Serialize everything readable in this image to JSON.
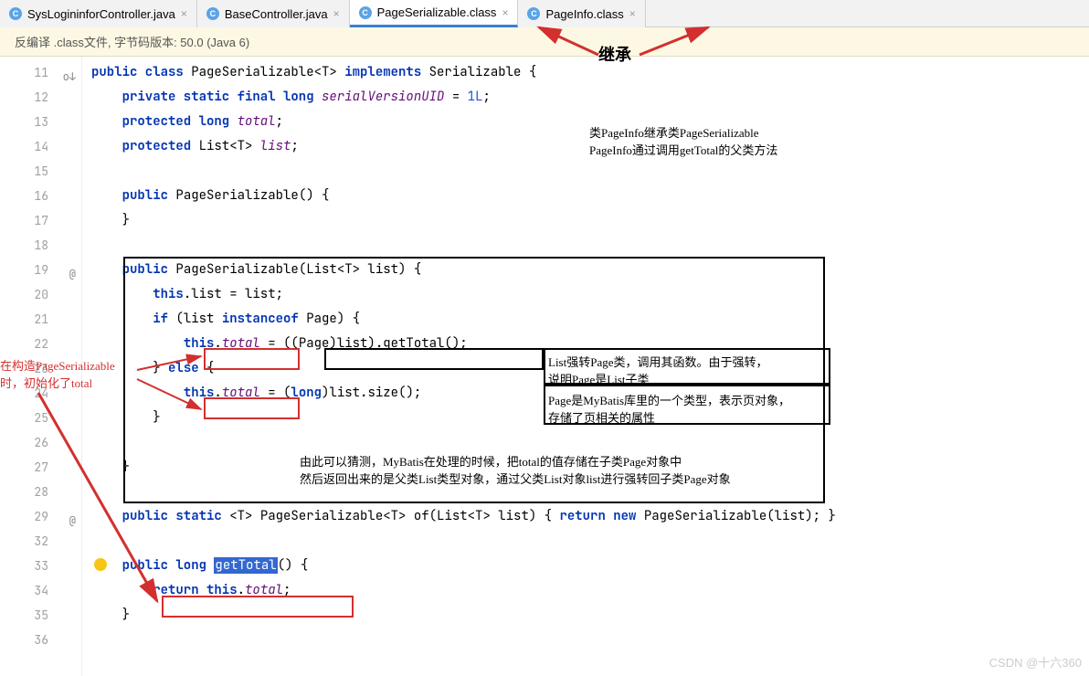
{
  "tabs": [
    {
      "label": "SysLogininforController.java",
      "icon": "C"
    },
    {
      "label": "BaseController.java",
      "icon": "C"
    },
    {
      "label": "PageSerializable.class",
      "icon": "C",
      "active": true
    },
    {
      "label": "PageInfo.class",
      "icon": "C"
    }
  ],
  "banner": "反编译 .class文件, 字节码版本: 50.0 (Java 6)",
  "lines": {
    "n11": "11",
    "n12": "12",
    "n13": "13",
    "n14": "14",
    "n15": "15",
    "n16": "16",
    "n17": "17",
    "n18": "18",
    "n19": "19",
    "n20": "20",
    "n21": "21",
    "n22": "22",
    "n23": "23",
    "n24": "24",
    "n25": "25",
    "n26": "26",
    "n27": "27",
    "n28": "28",
    "n29": "29",
    "n32": "32",
    "n33": "33",
    "n34": "34",
    "n35": "35",
    "n36": "36"
  },
  "code": {
    "l11": {
      "k1": "public class",
      "t1": " PageSerializable<",
      "t2": "T",
      "t3": "> ",
      "k2": "implements",
      "t4": " Serializable {"
    },
    "l12": {
      "k1": "private static final long ",
      "id": "serialVersionUID",
      "t1": " = ",
      "n": "1L",
      "t2": ";"
    },
    "l13": {
      "k1": "protected long ",
      "id": "total",
      "t1": ";"
    },
    "l14": {
      "k1": "protected ",
      "t1": "List<",
      "t2": "T",
      "t3": "> ",
      "id": "list",
      "t4": ";"
    },
    "l16": {
      "k1": "public",
      "t1": " PageSerializable() {"
    },
    "l17": {
      "t1": "}"
    },
    "l19": {
      "k1": "public",
      "t1": " PageSerializable(List<",
      "t2": "T",
      "t3": "> list) {"
    },
    "l20": {
      "k1": "this",
      "t1": ".list = list;"
    },
    "l21": {
      "k1": "if",
      "t1": " (list ",
      "k2": "instanceof",
      "t2": " Page) {"
    },
    "l22": {
      "k1": "this",
      "t1": ".",
      "id": "total",
      "t2": " = ",
      "t3": "((Page)list).getTotal();"
    },
    "l23": {
      "t1": "} ",
      "k1": "else",
      "t2": " {"
    },
    "l24": {
      "k1": "this",
      "t1": ".",
      "id": "total",
      "t2": " = (",
      "k2": "long",
      "t3": ")list.size();"
    },
    "l25": {
      "t1": "}"
    },
    "l27": {
      "t1": "}"
    },
    "l29": {
      "k1": "public static",
      "t1": " <",
      "t2": "T",
      "t3": "> PageSerializable<",
      "t4": "T",
      "t5": "> of(List<",
      "t6": "T",
      "t7": "> list) { ",
      "k2": "return new",
      "t8": " PageSerializable(list); }"
    },
    "l33": {
      "k0": "public long ",
      "m": "getTotal",
      "t1": "() {"
    },
    "l34": {
      "k1": "return this",
      "t1": ".",
      "id": "total",
      "t2": ";"
    },
    "l35": {
      "t1": "}"
    }
  },
  "ann": {
    "inherit": "继承",
    "topnote1": "类PageInfo继承类PageSerializable",
    "topnote2": "PageInfo通过调用getTotal的父类方法",
    "leftnote1": "在构造PageSerializable",
    "leftnote2": "时，初始化了total",
    "rnote1a": "List强转Page类，调用其函数。由于强转，",
    "rnote1b": "说明Page是List子类",
    "rnote2a": "Page是MyBatis库里的一个类型，表示页对象，",
    "rnote2b": "存储了页相关的属性",
    "bottomnote1": "由此可以猜测，MyBatis在处理的时候，把total的值存储在子类Page对象中",
    "bottomnote2": "然后返回出来的是父类List类型对象，通过父类List对象list进行强转回子类Page对象"
  },
  "watermark": "CSDN @十六360"
}
